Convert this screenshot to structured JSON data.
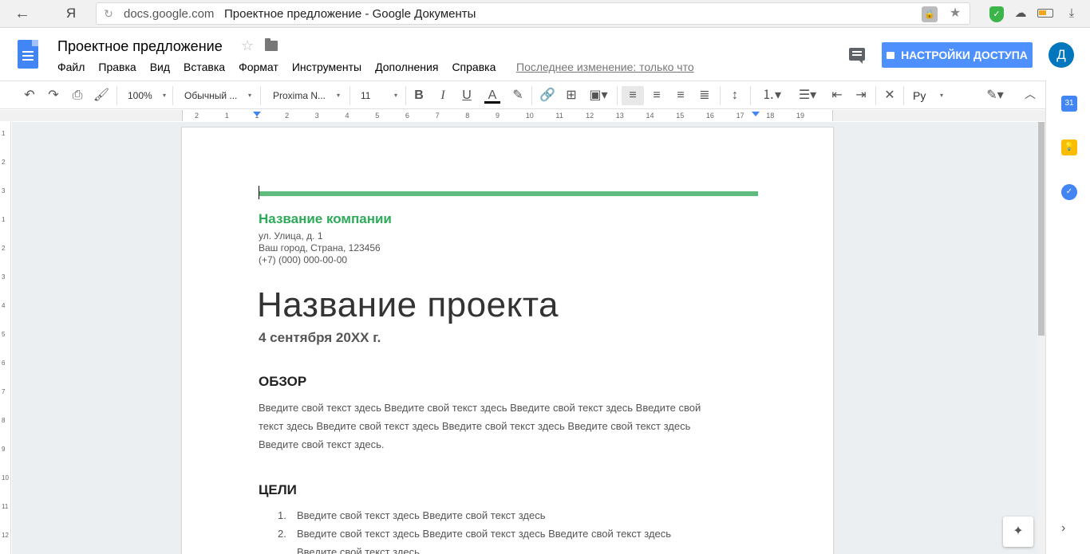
{
  "browser": {
    "back": "←",
    "ya": "Я",
    "domain": "docs.google.com",
    "tab_title": "Проектное предложение - Google Документы"
  },
  "docs": {
    "title": "Проектное предложение",
    "menu": [
      "Файл",
      "Правка",
      "Вид",
      "Вставка",
      "Формат",
      "Инструменты",
      "Дополнения",
      "Справка"
    ],
    "last_edit": "Последнее изменение: только что",
    "share_label": "НАСТРОЙКИ ДОСТУПА",
    "avatar_letter": "Д"
  },
  "toolbar": {
    "zoom": "100%",
    "style": "Обычный ...",
    "font": "Proxima N...",
    "size": "11",
    "input_tools": "Ру"
  },
  "ruler": {
    "labels": [
      "2",
      "1",
      "1",
      "2",
      "3",
      "4",
      "5",
      "6",
      "7",
      "8",
      "9",
      "10",
      "11",
      "12",
      "13",
      "14",
      "15",
      "16",
      "17",
      "18",
      "19"
    ]
  },
  "document": {
    "company": "Название компании",
    "address_line1": "ул. Улица, д. 1",
    "address_line2": "Ваш город, Страна, 123456",
    "phone": "(+7) (000) 000-00-00",
    "project_title": "Название проекта",
    "date": "4 сентября 20XX г.",
    "overview_heading": "ОБЗОР",
    "overview_line1": "Введите свой текст здесь Введите свой текст здесь Введите свой текст здесь Введите свой",
    "overview_line2": "текст здесь Введите свой текст здесь Введите свой текст здесь Введите свой текст здесь",
    "overview_line3": "Введите свой текст здесь.",
    "goals_heading": "ЦЕЛИ",
    "goals": [
      {
        "num": "1.",
        "text": "Введите свой текст здесь Введите свой текст здесь"
      },
      {
        "num": "2.",
        "text": "Введите свой текст здесь Введите свой текст здесь Введите свой текст здесь"
      },
      {
        "num": "",
        "text": "Введите свой текст здесь"
      }
    ]
  },
  "side_panel": {
    "calendar_day": "31"
  },
  "colors": {
    "accent_green": "#2eab59",
    "rule_green": "#5fba7d",
    "share_blue": "#4d90fe",
    "docs_blue": "#4285f4"
  }
}
